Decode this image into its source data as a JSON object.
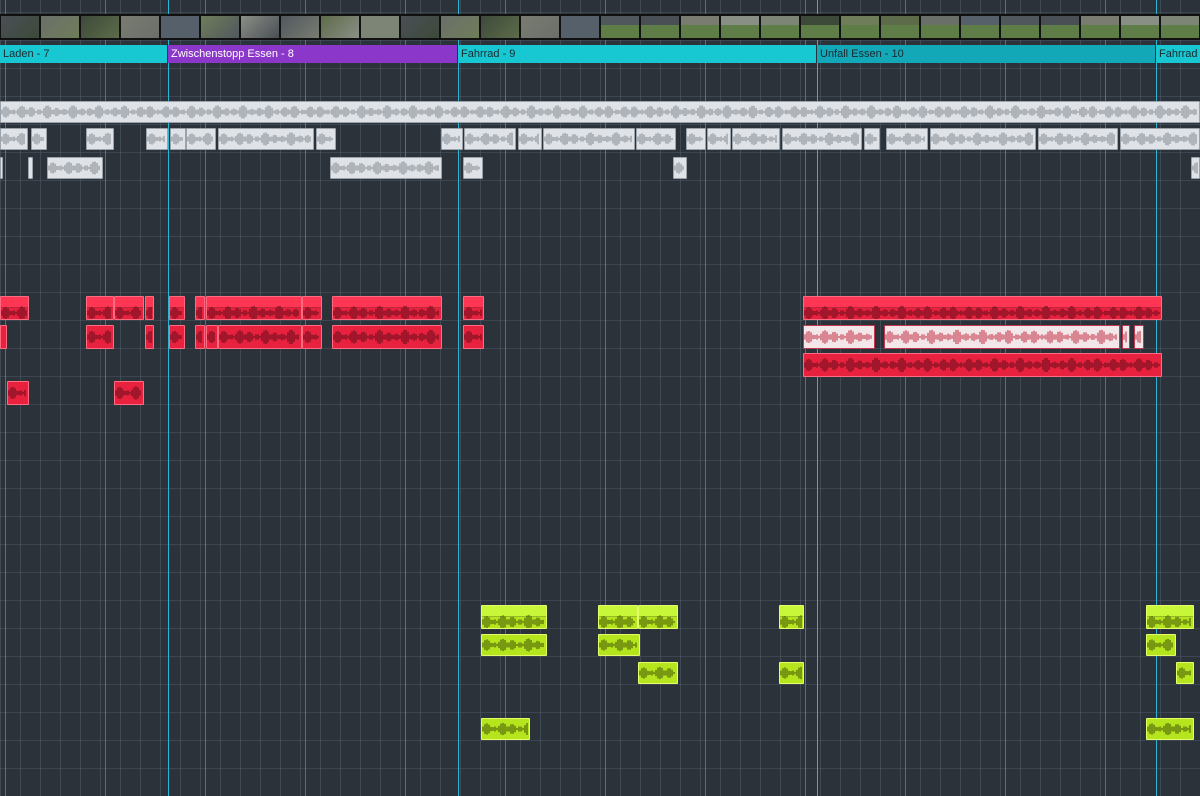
{
  "timeline": {
    "filmstrip_label": "Video filmstrip",
    "chapters": [
      {
        "label": "Laden -  7",
        "color": "#17c7d2"
      },
      {
        "label": "Zwischenstopp Essen -  8",
        "color": "#8b37c9"
      },
      {
        "label": "Fahrrad -  9",
        "color": "#17c7d2"
      },
      {
        "label": "Unfall Essen -  10",
        "color": "#12a8b8"
      },
      {
        "label": "Fahrrad",
        "color": "#17c7d2"
      }
    ],
    "colors": {
      "background": "#2b323a",
      "grey_clip": "#dfe3e7",
      "red_clip": "#e8213e",
      "green_clip": "#b5e61d",
      "marker": "#2bb4d4"
    }
  }
}
